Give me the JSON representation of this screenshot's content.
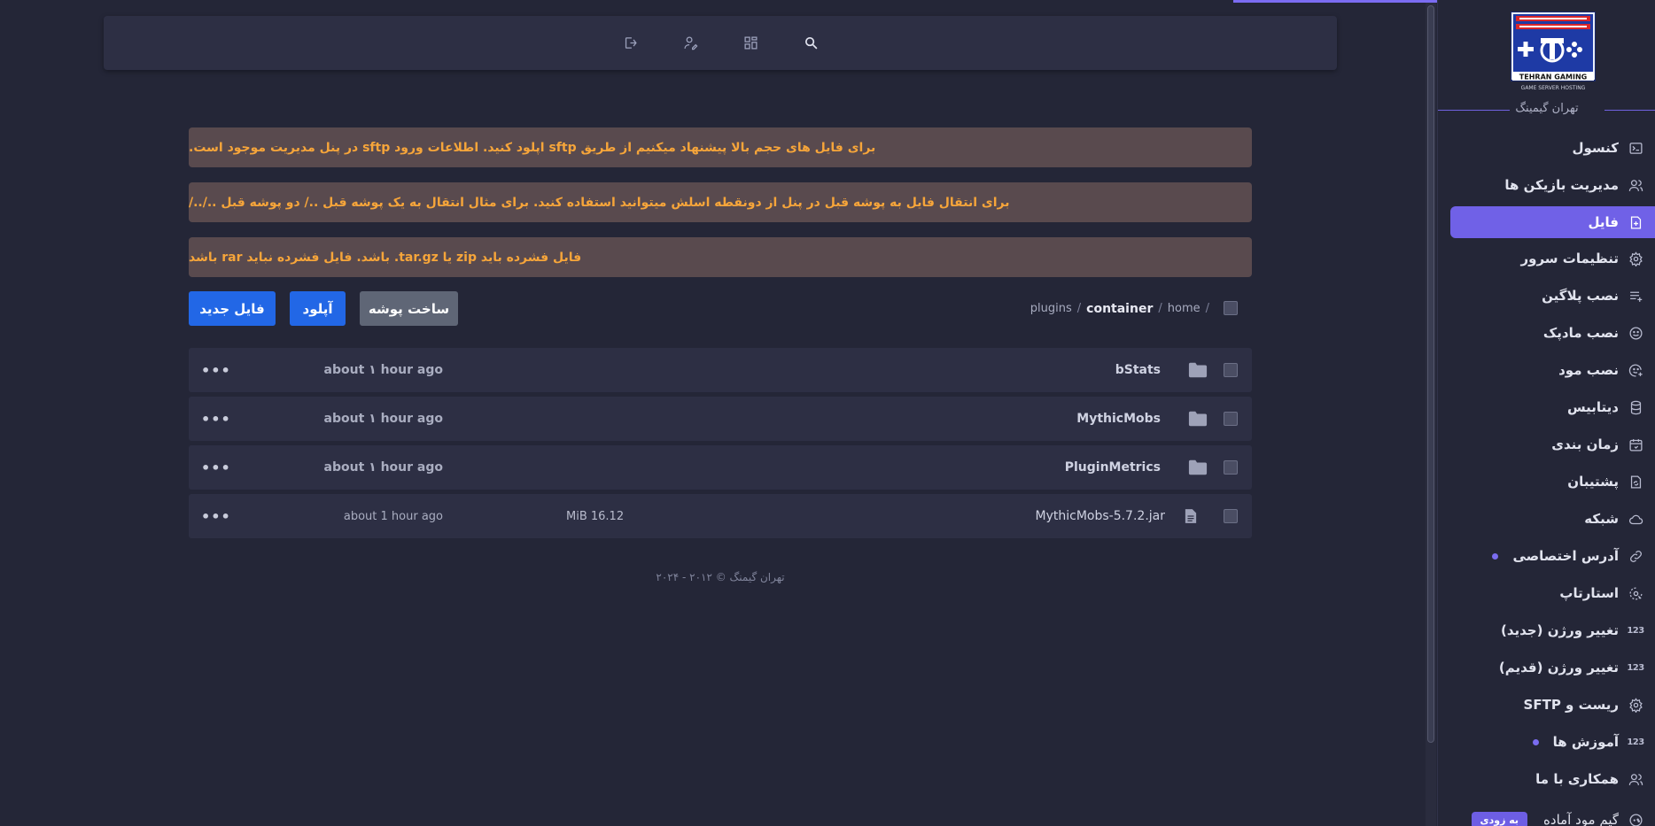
{
  "topbar": {
    "icons": [
      "logout-icon",
      "user-edit-icon",
      "dashboard-grid-icon",
      "search-icon"
    ]
  },
  "notices": [
    "برای فایل های حجم بالا پیشنهاد میکنیم از طریق sftp اپلود کنید. اطلاعات ورود sftp در پنل مدیریت موجود است.",
    "برای انتقال فایل به پوشه قبل در پنل از دونقطه اسلش میتوانید استفاده کنید. برای مثال انتقال به یک پوشه قبل ../ دو پوشه قبل ../../",
    "فایل فشرده باید zip یا tar.gz. باشد. فایل فشرده نباید rar باشد"
  ],
  "breadcrumb": {
    "root": "/",
    "home": "home",
    "sep1": "/",
    "container": "container",
    "sep2": "/",
    "plugins": "plugins"
  },
  "actions": {
    "new_file": "فایل جدید",
    "upload": "آپلود",
    "new_folder": "ساخت پوشه"
  },
  "files": [
    {
      "name": "bStats",
      "type": "folder",
      "size": "",
      "modified": "about ۱ hour ago"
    },
    {
      "name": "MythicMobs",
      "type": "folder",
      "size": "",
      "modified": "about ۱ hour ago"
    },
    {
      "name": "PluginMetrics",
      "type": "folder",
      "size": "",
      "modified": "about ۱ hour ago"
    },
    {
      "name": "MythicMobs-5.7.2.jar",
      "type": "file",
      "size": "MiB 16.12",
      "modified": "about 1 hour ago"
    }
  ],
  "row_menu": "•••",
  "footer": "تهران گیمنگ © ۲۰۱۲ - ۲۰۲۴",
  "sidebar": {
    "logo_text": "TEHRAN GAMING",
    "logo_subtext": "GAME SERVER HOSTING",
    "brand": "تهران گیمینگ",
    "items": [
      {
        "label": "کنسول",
        "icon": "console-icon"
      },
      {
        "label": "مدیریت بازیکن ها",
        "icon": "users-icon"
      },
      {
        "label": "فایل",
        "icon": "file-plus-icon"
      },
      {
        "label": "تنظیمات سرور",
        "icon": "gear-icon"
      },
      {
        "label": "نصب پلاگین",
        "icon": "list-plus-icon"
      },
      {
        "label": "نصب مادپک",
        "icon": "smile-icon"
      },
      {
        "label": "نصب مود",
        "icon": "smile-plus-icon"
      },
      {
        "label": "دیتابیس",
        "icon": "database-icon"
      },
      {
        "label": "زمان بندی",
        "icon": "calendar-icon"
      },
      {
        "label": "پشتیبان",
        "icon": "file-sync-icon"
      },
      {
        "label": "شبکه",
        "icon": "cloud-icon"
      },
      {
        "label": "آدرس اختصاصی",
        "icon": "link-icon"
      },
      {
        "label": "استارتاپ",
        "icon": "startup-icon"
      },
      {
        "label": "تغییر ورژن (جدید)",
        "icon": "numbers-icon"
      },
      {
        "label": "تغییر ورژن (قدیم)",
        "icon": "numbers-icon"
      },
      {
        "label": "ریست و SFTP",
        "icon": "gear-icon"
      },
      {
        "label": "آموزش ها",
        "icon": "numbers-icon"
      },
      {
        "label": "همکاری با ما",
        "icon": "users-icon"
      },
      {
        "label": "گیم مود آماده",
        "icon": "gamepad-icon"
      }
    ],
    "numbers_glyph": "123",
    "soon_badge": "به زودی"
  },
  "colors": {
    "accent": "#7061e7",
    "primary_button": "#2267e6",
    "notice_bg": "#594a4e",
    "notice_text": "#f6a53a"
  }
}
